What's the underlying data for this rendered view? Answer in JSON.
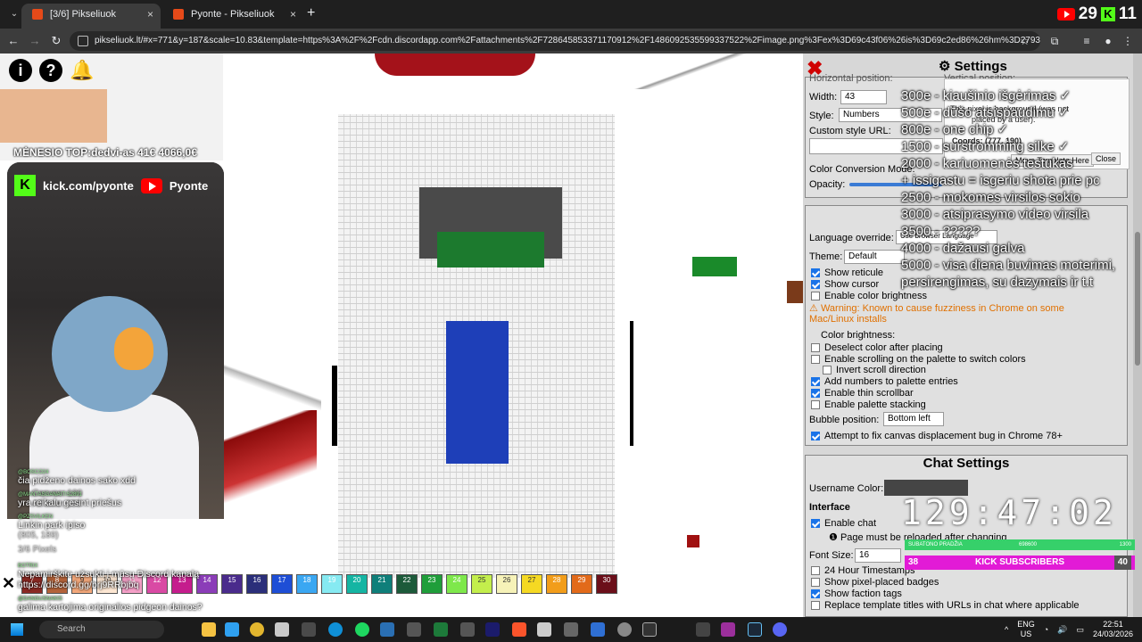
{
  "tabs": [
    {
      "label": "[3/6] Pikseliuok",
      "close": "×",
      "active": true,
      "icon": "pikseliuok-favicon"
    },
    {
      "label": "Pyonte - Pikseliuok",
      "close": "×",
      "active": false,
      "icon": "pikseliuok-favicon"
    }
  ],
  "new_tab": "+",
  "brand": {
    "yt_count": "29",
    "k_count": "11"
  },
  "url": "pikseliuok.lt/#x=771&y=187&scale=10.83&template=https%3A%2F%2Fcdn.discordapp.com%2Fattachments%2F728645853371170912%2F1486092535599337522%2Fimage.png%3Fex%3D69c43f06%26is%3D69c2ed86%26hm%3D279342bfa23cc77...",
  "overlay": {
    "top_line": "MĖNESIO TOP:dedvi-as 41€ 4066,0€",
    "kick": "kick.com/pyonte",
    "youtube": "Pyonte",
    "chat": [
      {
        "user": "@BOSCO24",
        "text": "čia pidženo dainos sako xdd"
      },
      {
        "user": "@MANTASGANAITIS2891",
        "text": "yra reikalu gesint priešus"
      },
      {
        "user": "@PZSVILKEN",
        "text": "Linkin park ipiso"
      },
      {
        "user": "BOTRIX",
        "text": "Nepamirškite užsukti į mūsų Discord kanalą https://discord.gg/brj9RRbjbq"
      },
      {
        "user": "@DANGUSNAKIS",
        "text": "galima kartojima originalios pidgeon dainos?"
      }
    ],
    "canvas_count": "Canvas: 100",
    "all_time": "All time: 100",
    "coords": "(805, 189)",
    "pixels": "3/6 Pixels"
  },
  "palette": [
    {
      "n": "7",
      "c": "#8b2a24"
    },
    {
      "n": "8",
      "c": "#b4633a"
    },
    {
      "n": "9",
      "c": "#f3a87b"
    },
    {
      "n": "10",
      "c": "#fde7d3"
    },
    {
      "n": "11",
      "c": "#f5a0c8"
    },
    {
      "n": "12",
      "c": "#d94aa4"
    },
    {
      "n": "13",
      "c": "#c51d8d"
    },
    {
      "n": "14",
      "c": "#8b3db8"
    },
    {
      "n": "15",
      "c": "#4a2b8c"
    },
    {
      "n": "16",
      "c": "#2b2f7a"
    },
    {
      "n": "17",
      "c": "#1e4ed6"
    },
    {
      "n": "18",
      "c": "#3aa7f2"
    },
    {
      "n": "19",
      "c": "#86eaf2"
    },
    {
      "n": "20",
      "c": "#15b5a3"
    },
    {
      "n": "21",
      "c": "#0f7f7a"
    },
    {
      "n": "22",
      "c": "#1c5a3a"
    },
    {
      "n": "23",
      "c": "#1f9e3a"
    },
    {
      "n": "24",
      "c": "#7ee84b"
    },
    {
      "n": "25",
      "c": "#c3ee4c"
    },
    {
      "n": "26",
      "c": "#f6f2b8"
    },
    {
      "n": "27",
      "c": "#f5d923"
    },
    {
      "n": "28",
      "c": "#f29d1a"
    },
    {
      "n": "29",
      "c": "#e26a1a"
    },
    {
      "n": "30",
      "c": "#6b0f1a"
    }
  ],
  "panel": {
    "title": "Settings",
    "labels": {
      "horizontal": "Horizontal position:",
      "vertical": "Vertical position:",
      "width": "Width:",
      "width_val": "43",
      "style": "Style:",
      "style_val": "Numbers",
      "custom_style": "Custom style URL:",
      "color_conv": "Color Conversion Mode:",
      "opacity": "Opacity:",
      "language": "Language override:",
      "language_val": "Use browser Language",
      "theme": "Theme:",
      "theme_val": "Default",
      "show_reticule": "Show reticule",
      "show_cursor": "Show cursor",
      "enable_brightness": "Enable color brightness",
      "warning": "Warning: Known to cause fuzziness in Chrome on some Mac/Linux installs",
      "color_brightness": "Color brightness:",
      "deselect": "Deselect color after placing",
      "scrolling": "Enable scrolling on the palette to switch colors",
      "invert": "Invert scroll direction",
      "add_numbers": "Add numbers to palette entries",
      "thin_scroll": "Enable thin scrollbar",
      "stacking": "Enable palette stacking",
      "bubble": "Bubble position:",
      "bubble_val": "Bottom left",
      "fix_canvas": "Attempt to fix canvas displacement bug in Chrome 78+"
    },
    "checks": {
      "show_reticule": true,
      "show_cursor": true,
      "enable_brightness": false,
      "deselect": false,
      "scrolling": false,
      "invert": false,
      "add_numbers": true,
      "thin_scroll": true,
      "stacking": false,
      "fix_canvas": true
    }
  },
  "popup": {
    "line1": "This pixel is background (was not",
    "line2": "placed by a user).",
    "coords": "Coords: (777, 190)",
    "move": "Move Template Here",
    "close": "Close"
  },
  "goals": [
    "300e - kiaušinio išgėrimas ✓",
    "500e - dūšo atsispaudimu ✓",
    "800e - one chip ✓",
    "1500 - surstromming silke ✓",
    "2000 - kariuomenės testukas",
    "+ issigastu = isgeriu shota prie pc",
    "2500 - mokomes virsilos sokio",
    "3000 - atsiprasymo video virsila",
    "3500 - ?????",
    "4000 - dažausi galva",
    "5000 - visa diena buvimas moterimi,",
    "persirengimas, su dazymais ir t.t"
  ],
  "chat_settings": {
    "title": "Chat Settings",
    "username_color": "Username Color:",
    "interface": "Interface",
    "enable_chat": "Enable chat",
    "reload_note": "Page must be reloaded after changing",
    "font_size": "Font Size:",
    "font_size_val": "16",
    "timestamps": "24 Hour Timestamps",
    "pixel_badges": "Show pixel-placed badges",
    "faction_tags": "Show faction tags",
    "replace_titles": "Replace template titles with URLs in chat where applicable"
  },
  "timer": "129:47:02",
  "subathon": {
    "label": "SUBATONO PRADŽIA",
    "val": "698600",
    "max": "1300"
  },
  "kick_goal": {
    "current": "38",
    "label": "KICK SUBSCRIBERS",
    "target": "40"
  },
  "taskbar": {
    "search": "Search",
    "lang": "ENG",
    "region": "US",
    "time": "22:51",
    "date": "24/03/2026"
  }
}
